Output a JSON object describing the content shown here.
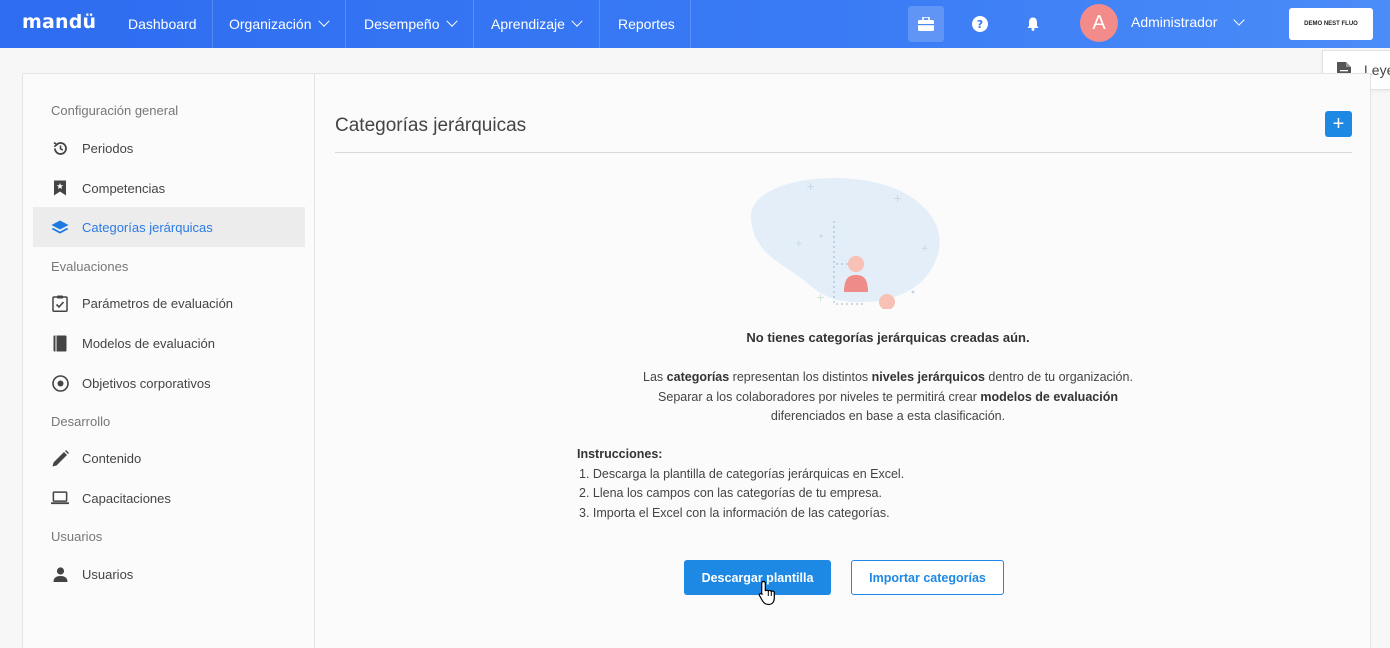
{
  "nav": {
    "logo": "mandü",
    "items": [
      {
        "label": "Dashboard",
        "dropdown": false
      },
      {
        "label": "Organización",
        "dropdown": true
      },
      {
        "label": "Desempeño",
        "dropdown": true
      },
      {
        "label": "Aprendizaje",
        "dropdown": true
      },
      {
        "label": "Reportes",
        "dropdown": false
      }
    ],
    "icons": [
      "briefcase-icon",
      "help-icon",
      "bell-icon"
    ],
    "avatar_letter": "A",
    "user_name": "Administrador",
    "company": "DEMO NEST FLUO"
  },
  "legend_tab": {
    "label": "Leye"
  },
  "sidebar": {
    "sections": [
      {
        "title": "Configuración general",
        "items": [
          {
            "label": "Periodos",
            "icon": "history-icon"
          },
          {
            "label": "Competencias",
            "icon": "bookmark-star-icon"
          },
          {
            "label": "Categorías jerárquicas",
            "icon": "layers-icon",
            "active": true
          }
        ]
      },
      {
        "title": "Evaluaciones",
        "items": [
          {
            "label": "Parámetros de evaluación",
            "icon": "clipboard-check-icon"
          },
          {
            "label": "Modelos de evaluación",
            "icon": "book-icon"
          },
          {
            "label": "Objetivos corporativos",
            "icon": "target-icon"
          }
        ]
      },
      {
        "title": "Desarrollo",
        "items": [
          {
            "label": "Contenido",
            "icon": "pencil-icon"
          },
          {
            "label": "Capacitaciones",
            "icon": "laptop-icon"
          }
        ]
      },
      {
        "title": "Usuarios",
        "items": [
          {
            "label": "Usuarios",
            "icon": "user-icon"
          }
        ]
      }
    ]
  },
  "main": {
    "title": "Categorías jerárquicas",
    "add_label": "+",
    "empty_title": "No tienes categorías jerárquicas creadas aún.",
    "desc": {
      "p1": "Las ",
      "b1": "categorías",
      "p2": " representan los distintos ",
      "b2": "niveles jerárquicos",
      "p3": " dentro de tu organización.",
      "p4": "Separar a los colaboradores por niveles te permitirá crear ",
      "b3": "modelos de evaluación",
      "p5": "diferenciados en base a esta clasificación."
    },
    "instructions": {
      "title": "Instrucciones:",
      "steps": [
        "1. Descarga la plantilla de categorías jerárquicas en Excel.",
        "2. Llena los campos con las categorías de tu empresa.",
        "3. Importa el Excel con la información de las categorías."
      ]
    },
    "buttons": {
      "download": "Descargar plantilla",
      "import": "Importar categorías"
    }
  },
  "colors": {
    "nav": "#3a7bf5",
    "accent": "#1e88e5",
    "avatar": "#f38b8b",
    "active_item": "#2b7be4"
  }
}
